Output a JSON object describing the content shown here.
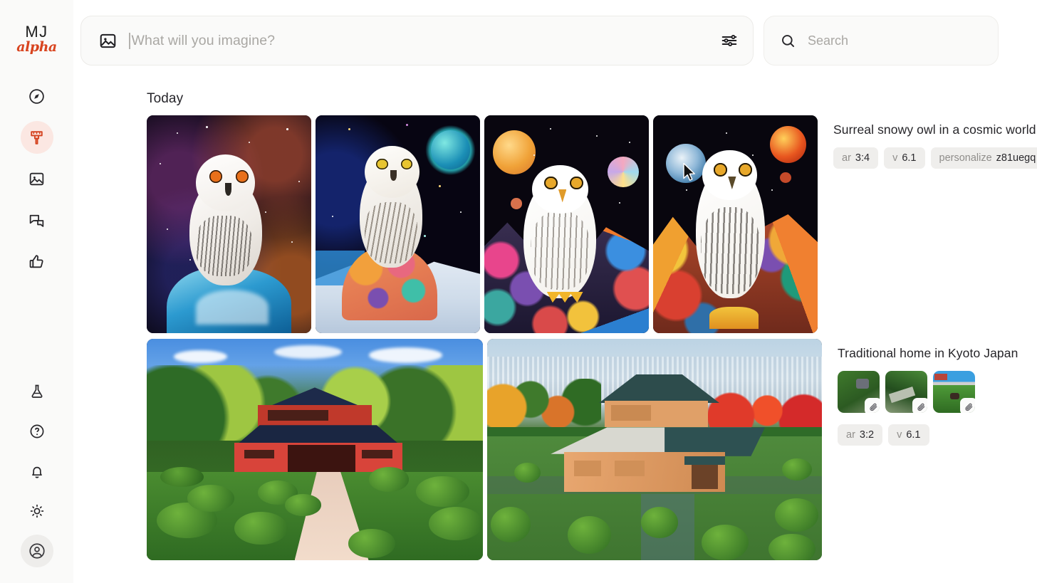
{
  "app": {
    "logo_primary": "MJ",
    "logo_secondary": "alpha"
  },
  "sidebar": {
    "top_items": [
      {
        "name": "explore",
        "icon": "compass-icon",
        "active": false
      },
      {
        "name": "create",
        "icon": "paintbrush-icon",
        "active": true
      },
      {
        "name": "gallery",
        "icon": "image-icon",
        "active": false
      },
      {
        "name": "chat",
        "icon": "chat-bubbles-icon",
        "active": false
      },
      {
        "name": "rate",
        "icon": "thumbs-up-icon",
        "active": false
      }
    ],
    "bottom_items": [
      {
        "name": "lab",
        "icon": "flask-icon"
      },
      {
        "name": "help",
        "icon": "question-circle-icon"
      },
      {
        "name": "updates",
        "icon": "bell-icon"
      },
      {
        "name": "theme",
        "icon": "sun-icon"
      },
      {
        "name": "account",
        "icon": "user-circle-icon"
      }
    ]
  },
  "prompt": {
    "icon": "image-icon",
    "placeholder": "What will you imagine?",
    "value": "",
    "settings_icon": "sliders-icon"
  },
  "search": {
    "icon": "search-icon",
    "placeholder": "Search",
    "value": ""
  },
  "main": {
    "section_label": "Today",
    "groups": [
      {
        "title": "Surreal snowy owl in a cosmic world",
        "images": [
          {
            "alt": "Snowy owl with orange eyes on icy blue rock in nebula"
          },
          {
            "alt": "Painterly snowy owl on colorful rock with teal planet"
          },
          {
            "alt": "Collage snowy owl with orange planet and patchwork mountains"
          },
          {
            "alt": "Collage snowy owl with blue planet and colorful mountains"
          }
        ],
        "pills": [
          {
            "key": "ar",
            "value": "3:4"
          },
          {
            "key": "v",
            "value": "6.1"
          },
          {
            "key": "personalize",
            "value": "z81uegq"
          }
        ],
        "references": []
      },
      {
        "title": "Traditional home in Kyoto Japan",
        "images": [
          {
            "alt": "Red traditional Japanese house with blue tiled roof in green garden"
          },
          {
            "alt": "Wooden Japanese house with dark roof overlooking Kyoto city"
          }
        ],
        "pills": [
          {
            "key": "ar",
            "value": "3:2"
          },
          {
            "key": "v",
            "value": "6.1"
          }
        ],
        "references": [
          {
            "alt": "Green garden reference thumbnail",
            "badge": "paperclip-icon"
          },
          {
            "alt": "Green field reference thumbnail",
            "badge": "paperclip-icon"
          },
          {
            "alt": "Green field with blue sky reference thumbnail",
            "badge": "paperclip-icon"
          }
        ]
      }
    ]
  },
  "colors": {
    "accent": "#d4421f",
    "accent_soft": "#fbe7e2",
    "sidebar_bg": "#fafaf9",
    "pill_bg": "#efeeec",
    "text": "#26252a",
    "muted": "#a9a7a3"
  }
}
